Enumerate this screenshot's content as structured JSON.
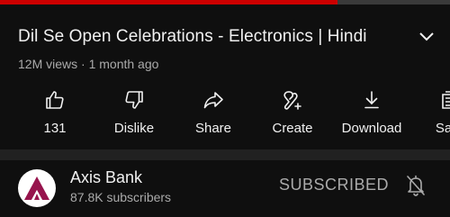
{
  "player": {
    "progress_fraction": 0.75,
    "progress_color": "#cc0000"
  },
  "video": {
    "title": "Dil Se Open Celebrations - Electronics | Hindi",
    "meta": "12M views · 1 month ago",
    "expand_icon": "chevron-down-icon"
  },
  "actions": [
    {
      "id": "like",
      "label": "131",
      "icon": "thumbs-up-icon"
    },
    {
      "id": "dislike",
      "label": "Dislike",
      "icon": "thumbs-down-icon"
    },
    {
      "id": "share",
      "label": "Share",
      "icon": "share-icon"
    },
    {
      "id": "create",
      "label": "Create",
      "icon": "create-icon"
    },
    {
      "id": "download",
      "label": "Download",
      "icon": "download-icon"
    },
    {
      "id": "save",
      "label": "Save",
      "icon": "save-icon"
    }
  ],
  "channel": {
    "name": "Axis Bank",
    "subscribers": "87.8K subscribers",
    "subscribe_label": "SUBSCRIBED",
    "avatar_color": "#97144d",
    "bell_icon": "bell-off-icon"
  }
}
